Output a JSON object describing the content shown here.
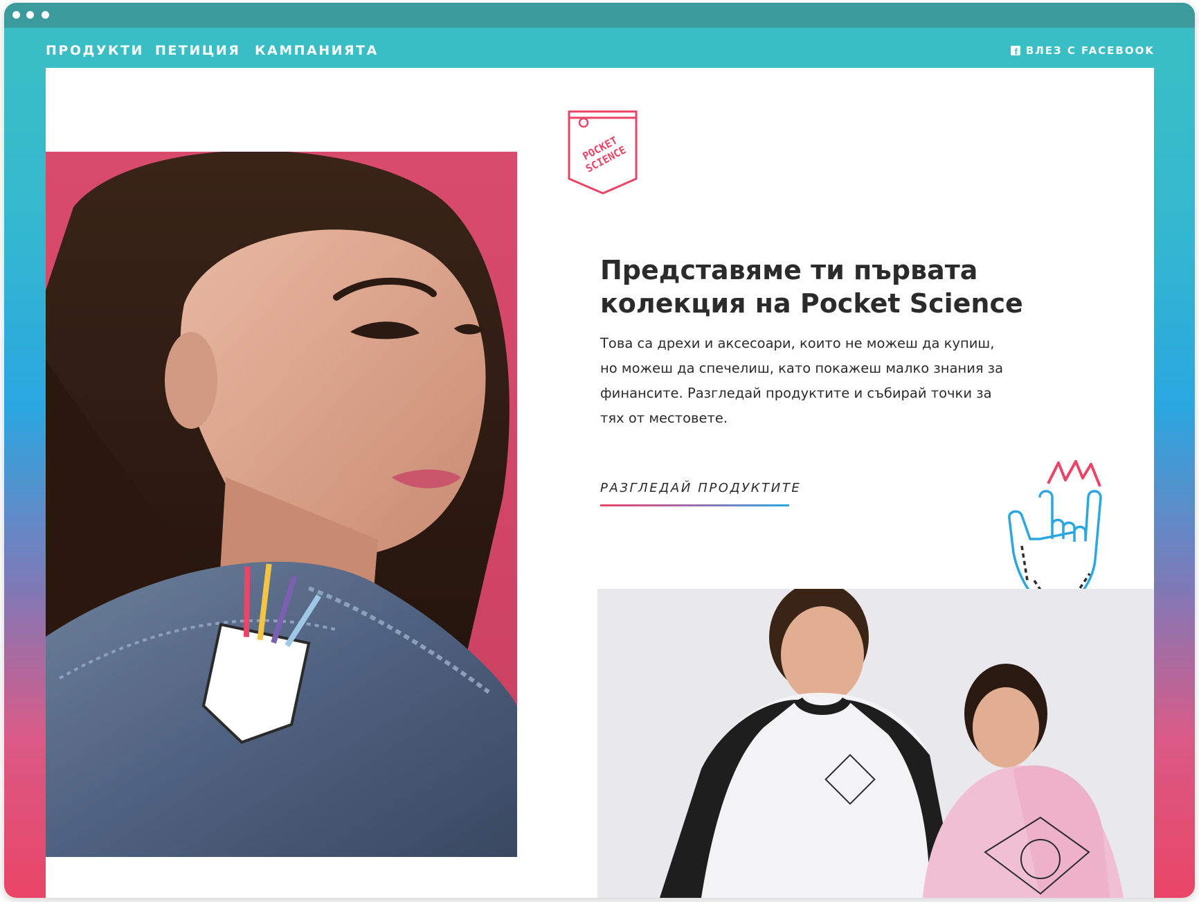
{
  "window": {
    "controls": [
      "dot",
      "dot",
      "dot"
    ]
  },
  "nav": {
    "items": [
      {
        "label": "ПРОДУКТИ"
      },
      {
        "label": "ПЕТИЦИЯ"
      },
      {
        "label": "КАМПАНИЯТА"
      }
    ],
    "login_label": "ВЛЕЗ С FACEBOOK",
    "login_icon": "facebook-icon"
  },
  "logo": {
    "line1": "POCKET",
    "line2": "SCIENCE"
  },
  "hero": {
    "headline_line1": "Представяме ти първата",
    "headline_line2": "колекция на Pocket Science",
    "body_line1": "Това са дрехи и аксесоари, които не можеш да купиш,",
    "body_line2": "но можеш да спечелиш, като покажеш малко знания за",
    "body_line3": "финансите. Разгледай продуктите и събирай точки за",
    "body_line4": "тях от местовете.",
    "cta_label": "РАЗГЛЕДАЙ ПРОДУКТИТЕ"
  },
  "colors": {
    "brand_pink": "#ea4566",
    "brand_teal": "#3cc0c3",
    "brand_blue": "#2aa7e0",
    "text_dark": "#2b2b2b"
  },
  "decor": {
    "hand_icon": "rock-hand-icon",
    "sparkle_icon": "sparkle-icon"
  }
}
